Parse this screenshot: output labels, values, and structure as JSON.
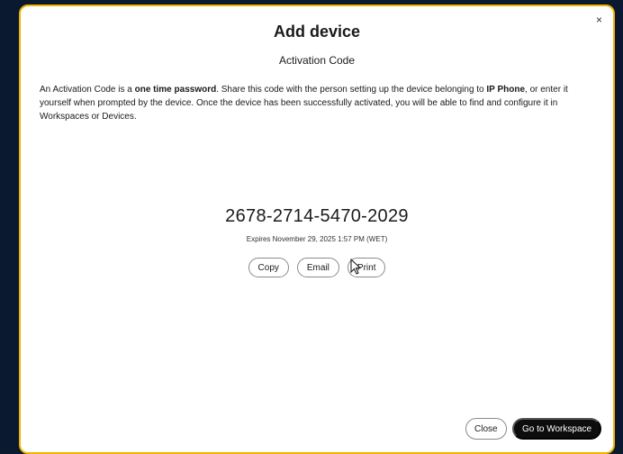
{
  "dialog": {
    "close_glyph": "×",
    "title": "Add device",
    "subtitle": "Activation Code",
    "description": {
      "part1": "An Activation Code is a ",
      "bold1": "one time password",
      "part2": ". Share this code with the person setting up the device belonging to ",
      "bold2": "IP Phone",
      "part3": ", or enter it yourself when prompted by the device. Once the device has been successfully activated, you will be able to find and configure it in Workspaces or Devices."
    },
    "code": "2678-2714-5470-2029",
    "expires": "Expires November 29, 2025 1:57 PM (WET)",
    "actions": {
      "copy": "Copy",
      "email": "Email",
      "print": "Print"
    },
    "footer": {
      "close": "Close",
      "go_to_workspace": "Go to Workspace"
    }
  },
  "colors": {
    "border_accent": "#f0b400",
    "primary_button": "#0d0d0d",
    "backdrop": "#0a1930"
  },
  "icons": {
    "close": "close-icon",
    "cursor": "mouse-pointer-icon"
  }
}
